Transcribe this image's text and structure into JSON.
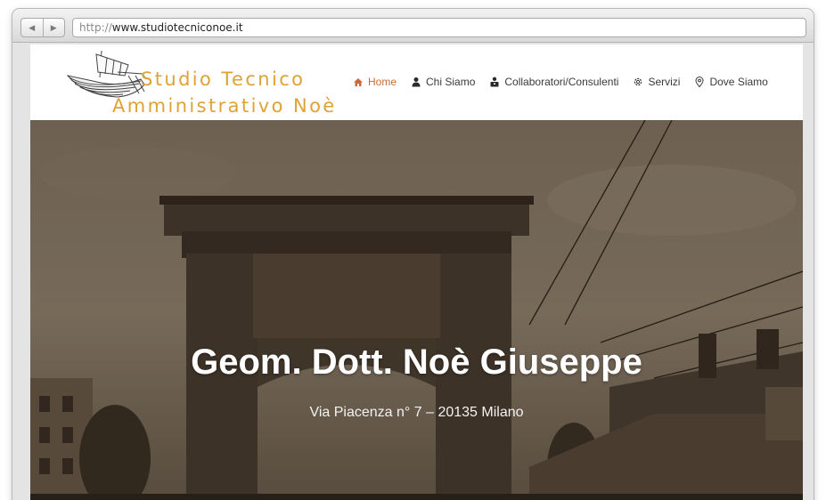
{
  "browser": {
    "back_glyph": "◀",
    "forward_glyph": "▶",
    "url_protocol": "http://",
    "url_host": "www.studiotecniconoe.it"
  },
  "logo": {
    "line1": "Studio Tecnico",
    "line2": "Amministrativo Noè",
    "icon": "boat-icon"
  },
  "nav": {
    "items": [
      {
        "label": "Home",
        "icon": "home-icon",
        "active": true
      },
      {
        "label": "Chi Siamo",
        "icon": "user-icon",
        "active": false
      },
      {
        "label": "Collaboratori/Consulenti",
        "icon": "briefcase-user-icon",
        "active": false
      },
      {
        "label": "Servizi",
        "icon": "gear-icon",
        "active": false
      },
      {
        "label": "Dove Siamo",
        "icon": "map-pin-icon",
        "active": false
      }
    ]
  },
  "hero": {
    "title": "Geom. Dott. Noè Giuseppe",
    "subtitle": "Via Piacenza n° 7 – 20135 Milano"
  },
  "colors": {
    "logo_accent": "#e0a236",
    "nav_active": "#c96a3a",
    "nav_text": "#3a3a3a"
  }
}
